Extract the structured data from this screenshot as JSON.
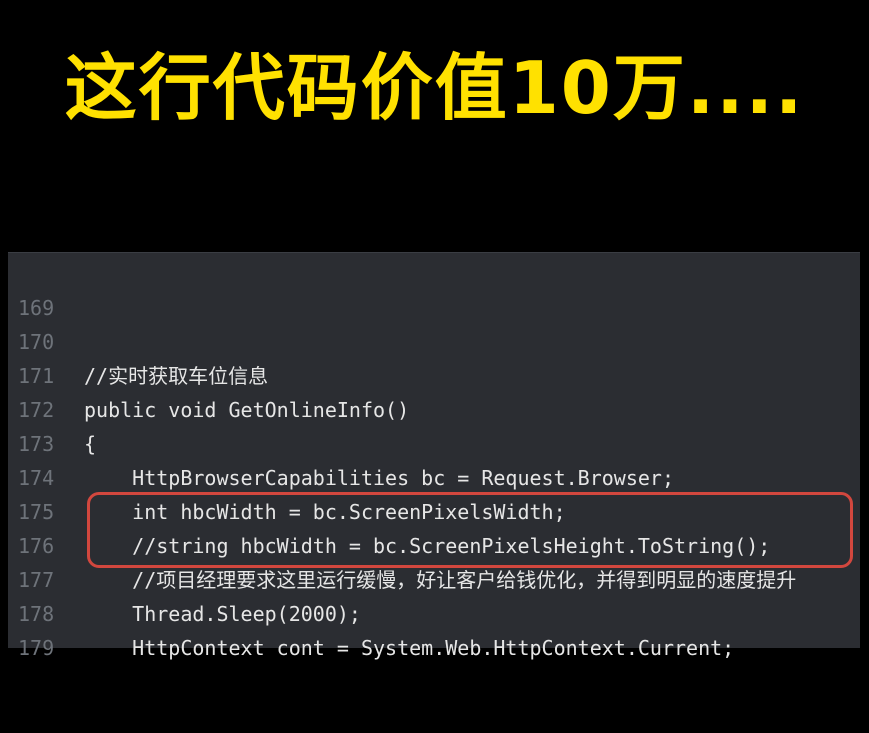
{
  "headline": "这行代码价值10万....",
  "colors": {
    "headline": "#FFE100",
    "background": "#000000",
    "editor_bg": "#2B2D32",
    "line_number": "#6E737A",
    "code_text": "#E6E6E6",
    "highlight_border": "#D2473E"
  },
  "editor": {
    "lines": [
      {
        "num": "169",
        "code": ""
      },
      {
        "num": "170",
        "code": "//实时获取车位信息"
      },
      {
        "num": "171",
        "code": "public void GetOnlineInfo()"
      },
      {
        "num": "172",
        "code": "{"
      },
      {
        "num": "173",
        "code": "    HttpBrowserCapabilities bc = Request.Browser;"
      },
      {
        "num": "174",
        "code": "    int hbcWidth = bc.ScreenPixelsWidth;"
      },
      {
        "num": "175",
        "code": "    //string hbcWidth = bc.ScreenPixelsHeight.ToString();"
      },
      {
        "num": "176",
        "code": "    //项目经理要求这里运行缓慢，好让客户给钱优化，并得到明显的速度提升"
      },
      {
        "num": "177",
        "code": "    Thread.Sleep(2000);"
      },
      {
        "num": "178",
        "code": "    HttpContext cont = System.Web.HttpContext.Current;"
      },
      {
        "num": "179",
        "code": ""
      }
    ]
  }
}
